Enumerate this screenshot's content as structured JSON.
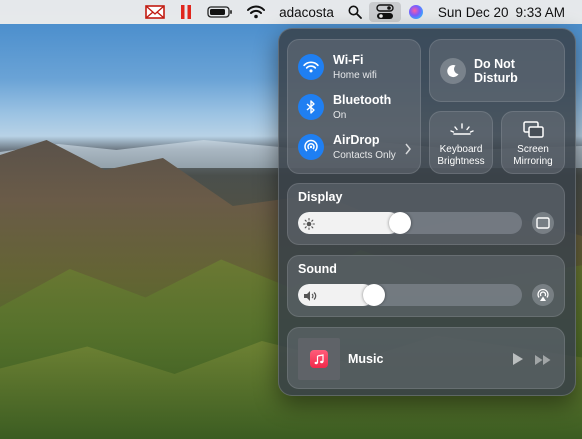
{
  "menubar": {
    "user": "adacosta",
    "date": "Sun Dec 20",
    "time": "9:33 AM",
    "icons": [
      "mail-alert-icon",
      "pause-icon",
      "battery-icon",
      "wifi-icon",
      "search-icon",
      "control-center-icon",
      "siri-icon"
    ]
  },
  "network": {
    "wifi": {
      "title": "Wi-Fi",
      "subtitle": "Home wifi"
    },
    "bluetooth": {
      "title": "Bluetooth",
      "subtitle": "On"
    },
    "airdrop": {
      "title": "AirDrop",
      "subtitle": "Contacts Only"
    }
  },
  "dnd": {
    "label_line1": "Do Not",
    "label_line2": "Disturb"
  },
  "keyboard": {
    "label_line1": "Keyboard",
    "label_line2": "Brightness"
  },
  "mirroring": {
    "label_line1": "Screen",
    "label_line2": "Mirroring"
  },
  "display": {
    "title": "Display",
    "level": 0.45
  },
  "sound": {
    "title": "Sound",
    "level": 0.32
  },
  "music": {
    "title": "Music"
  },
  "colors": {
    "accent": "#1f7ff2",
    "alert_red": "#e0261d"
  }
}
